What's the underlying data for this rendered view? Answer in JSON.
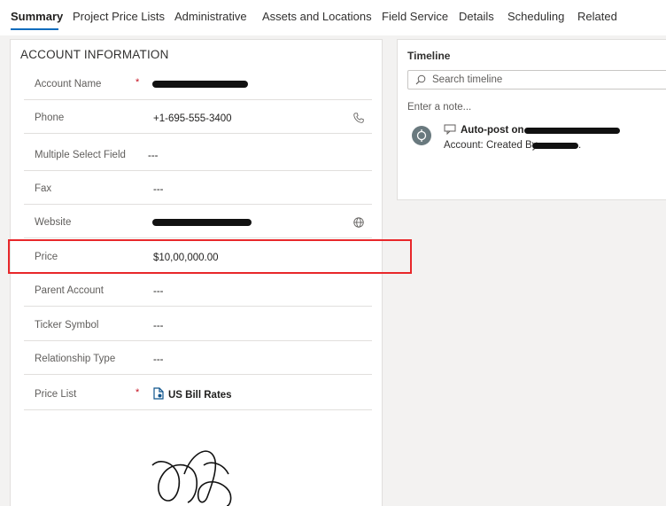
{
  "tabs": [
    "Summary",
    "Project Price Lists",
    "Administrative",
    "Assets and Locations",
    "Field Service",
    "Details",
    "Scheduling",
    "Related"
  ],
  "account_info": {
    "title": "ACCOUNT INFORMATION",
    "fields": [
      {
        "label": "Account Name",
        "required": "*",
        "value": ""
      },
      {
        "label": "Phone",
        "required": "",
        "value": "+1-695-555-3400"
      },
      {
        "label": "Multiple Select Field",
        "required": "",
        "value": "---"
      },
      {
        "label": "Fax",
        "required": "",
        "value": "---"
      },
      {
        "label": "Website",
        "required": "",
        "value": ""
      },
      {
        "label": "Price",
        "required": "",
        "value": "$10,00,000.00"
      },
      {
        "label": "Parent Account",
        "required": "",
        "value": "---"
      },
      {
        "label": "Ticker Symbol",
        "required": "",
        "value": "---"
      },
      {
        "label": "Relationship Type",
        "required": "",
        "value": "---"
      },
      {
        "label": "Price List",
        "required": "*",
        "value": "US Bill Rates"
      }
    ]
  },
  "timeline": {
    "title": "Timeline",
    "search_placeholder": "Search timeline",
    "note_placeholder": "Enter a note...",
    "post": {
      "title": "Auto-post on",
      "subtitle": "Account: Created By"
    }
  },
  "icons": {
    "phone": "phone-icon",
    "website": "globe-icon",
    "search": "search-icon",
    "price_list": "document-icon",
    "post": "auto-post-icon",
    "avatar": "bot-avatar-icon"
  },
  "colors": {
    "accent": "#0f6cbd",
    "highlight": "#e8272a",
    "required": "#c50f1f",
    "link": "#0f548c"
  }
}
